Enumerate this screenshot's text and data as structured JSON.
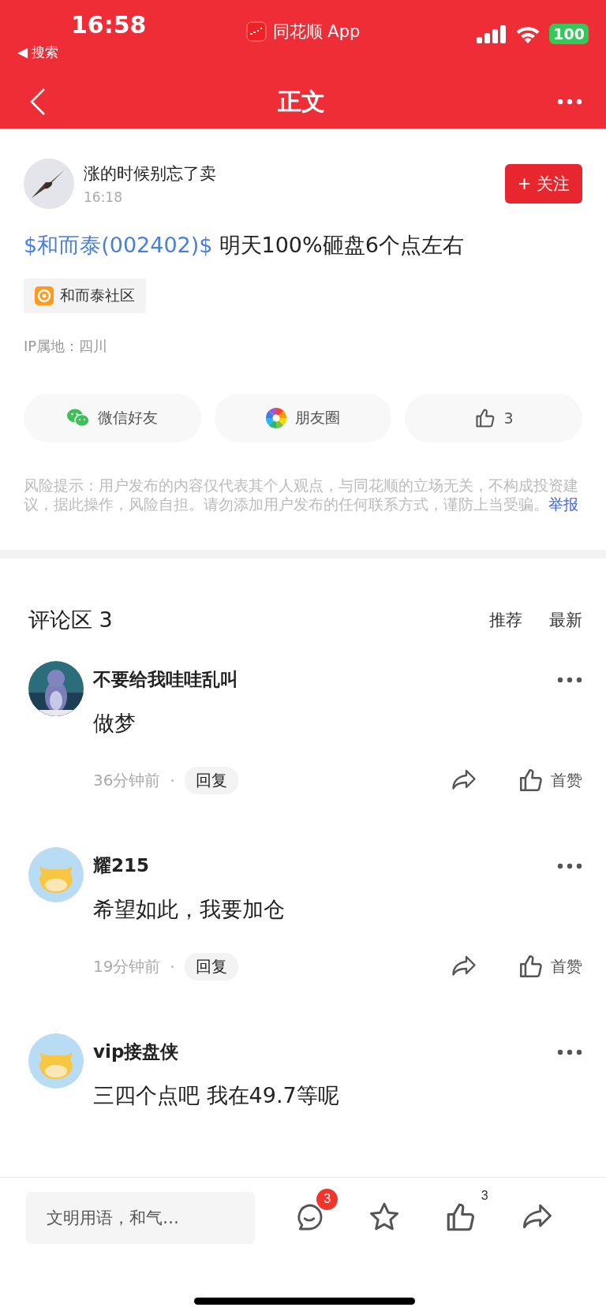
{
  "status_bar": {
    "time": "16:58",
    "back_app": "◀ 搜索",
    "app_name": "同花顺 App",
    "battery": "100"
  },
  "nav": {
    "title": "正文"
  },
  "post": {
    "author": "涨的时候别忘了卖",
    "time": "16:18",
    "follow": "+ 关注",
    "text": "$和而泰(002402)$",
    "text_rest": "明天100%砸盘6个点左右",
    "community": "和而泰社区",
    "ip": "IP属地：四川",
    "share": [
      {
        "kind": "wechat",
        "label": "微信好友"
      },
      {
        "kind": "moments",
        "label": "朋友圈"
      },
      {
        "kind": "like",
        "label": "3"
      }
    ],
    "risk": "风险提示：用户发布的内容仅代表其个人观点，与同花顺的立场无关，不构成投资建议，据此操作，风险自担。请勿添加用户发布的任何联系方式，谨防上当受骗。",
    "report": "举报"
  },
  "comments_header": {
    "title": "评论区 3",
    "sort": [
      "推荐",
      "最新"
    ]
  },
  "comments": [
    {
      "name": "不要给我哇哇乱叫",
      "text": "做梦",
      "time": "36分钟前",
      "reply": "回复",
      "like": "首赞"
    },
    {
      "avatar": {
        "kind": "default"
      },
      "name": "耀215",
      "text": "希望如此，我要加仓",
      "time": "19分钟前",
      "reply": "回复",
      "like": "首赞"
    },
    {
      "avatar": {
        "kind": "default"
      },
      "name": "vip接盘侠",
      "text": "三四个点吧 我在49.7等呢"
    }
  ],
  "bottom_bar": {
    "placeholder": "文明用语，和气…",
    "comment_badge": "3",
    "like_count": "3"
  }
}
